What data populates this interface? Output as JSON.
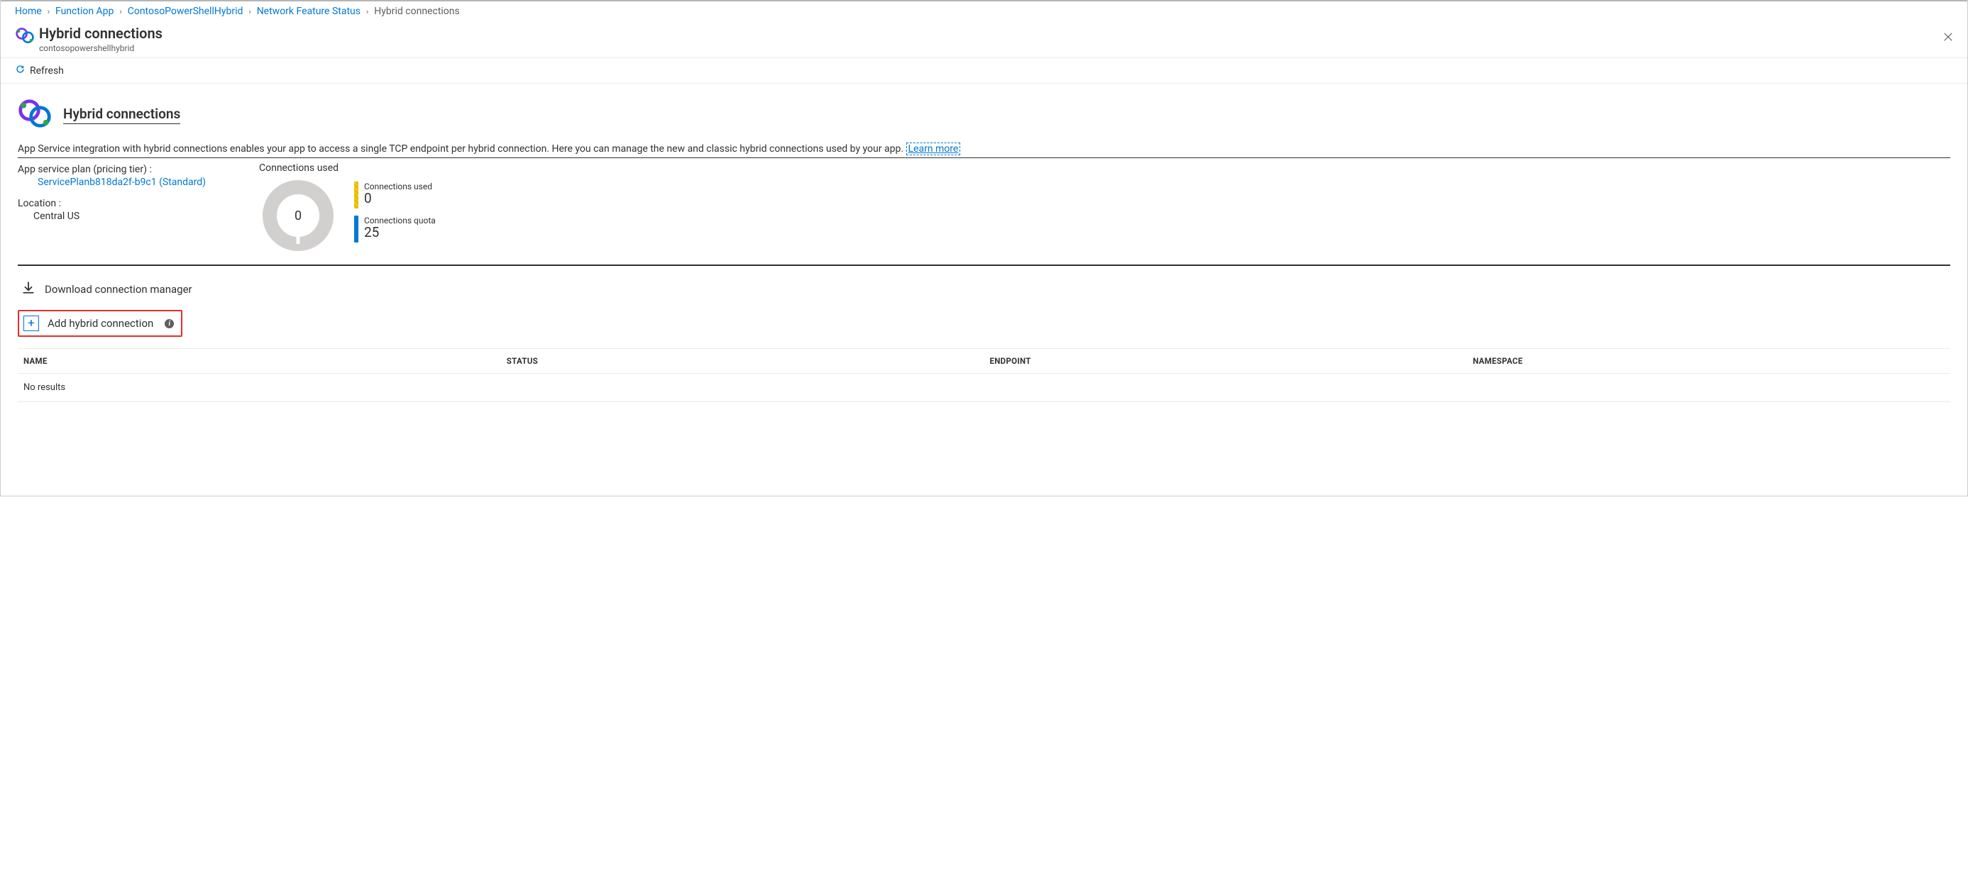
{
  "breadcrumb": {
    "items": [
      {
        "label": "Home",
        "link": true
      },
      {
        "label": "Function App",
        "link": true
      },
      {
        "label": "ContosoPowerShellHybrid",
        "link": true
      },
      {
        "label": "Network Feature Status",
        "link": true
      },
      {
        "label": "Hybrid connections",
        "link": false
      }
    ]
  },
  "header": {
    "title": "Hybrid connections",
    "subtitle": "contosopowershellhybrid"
  },
  "toolbar": {
    "refresh": "Refresh"
  },
  "section": {
    "title": "Hybrid connections",
    "description": "App Service integration with hybrid connections enables your app to access a single TCP endpoint per hybrid connection. Here you can manage the new and classic hybrid connections used by your app.",
    "learn_more": "Learn more"
  },
  "plan": {
    "label": "App service plan (pricing tier) :",
    "name": "ServicePlanb818da2f-b9c1 (Standard)",
    "location_label": "Location :",
    "location": "Central US"
  },
  "connections": {
    "header": "Connections used",
    "donut_center": "0",
    "used_label": "Connections used",
    "used_value": "0",
    "quota_label": "Connections quota",
    "quota_value": "25"
  },
  "download": {
    "label": "Download connection manager"
  },
  "add": {
    "label": "Add hybrid connection"
  },
  "table": {
    "columns": [
      "NAME",
      "STATUS",
      "ENDPOINT",
      "NAMESPACE"
    ],
    "empty": "No results"
  },
  "chart_data": {
    "type": "pie",
    "title": "Connections used",
    "series": [
      {
        "name": "Connections used",
        "value": 0
      },
      {
        "name": "Connections quota",
        "value": 25
      }
    ]
  }
}
